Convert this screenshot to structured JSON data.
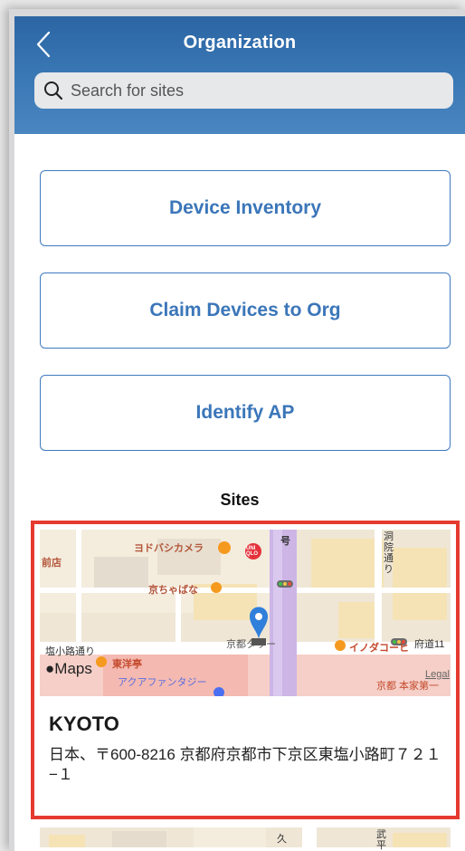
{
  "header": {
    "title": "Organization",
    "search_placeholder": "Search for sites"
  },
  "actions": [
    {
      "label": "Device Inventory"
    },
    {
      "label": "Claim Devices to Org"
    },
    {
      "label": "Identify AP"
    }
  ],
  "sites_heading": "Sites",
  "sites": [
    {
      "name": "KYOTO",
      "address": "日本、〒600-8216 京都府京都市下京区東塩小路町７２１−１",
      "map_labels": {
        "l1": "前店",
        "l2": "ヨドバシカメラ",
        "l3": "京ちゃばな",
        "l4": "京都タワー",
        "l5": "塩小路通り",
        "l6": "府道11",
        "l7": "東洋亭",
        "l8": "アクアファンタジー",
        "l9": "イノダコーヒ",
        "l10": "京都 本家第一",
        "l11": "洞院通り",
        "l12": "号",
        "legal": "Legal",
        "maps": "Maps",
        "l13": "UNI QLO"
      }
    },
    {
      "map_labels": {
        "k1": "久",
        "k2": "武平"
      }
    }
  ],
  "colors": {
    "header_blue": "#3a76b4",
    "accent_blue": "#3b76b9",
    "highlight_red": "#e53a2f"
  }
}
